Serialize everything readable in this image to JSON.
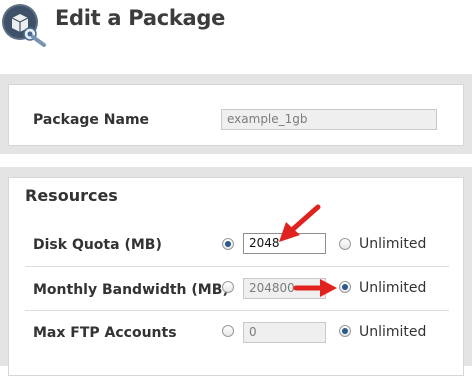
{
  "page": {
    "title": "Edit a Package",
    "icon": "package-settings-icon"
  },
  "package_section": {
    "name_label": "Package Name",
    "name_value": "example_1gb"
  },
  "resources": {
    "title": "Resources",
    "rows": [
      {
        "label": "Disk Quota (MB)",
        "value": "2048",
        "selected": "custom",
        "unlimited_label": "Unlimited"
      },
      {
        "label": "Monthly Bandwidth (MB)",
        "value": "204800",
        "selected": "unlimited",
        "unlimited_label": "Unlimited"
      },
      {
        "label": "Max FTP Accounts",
        "value": "0",
        "selected": "unlimited",
        "unlimited_label": "Unlimited"
      }
    ]
  },
  "colors": {
    "accent_arrow": "#e0231e",
    "radio_dot": "#2a5a8c",
    "panel_bg": "#e4e4e4"
  }
}
